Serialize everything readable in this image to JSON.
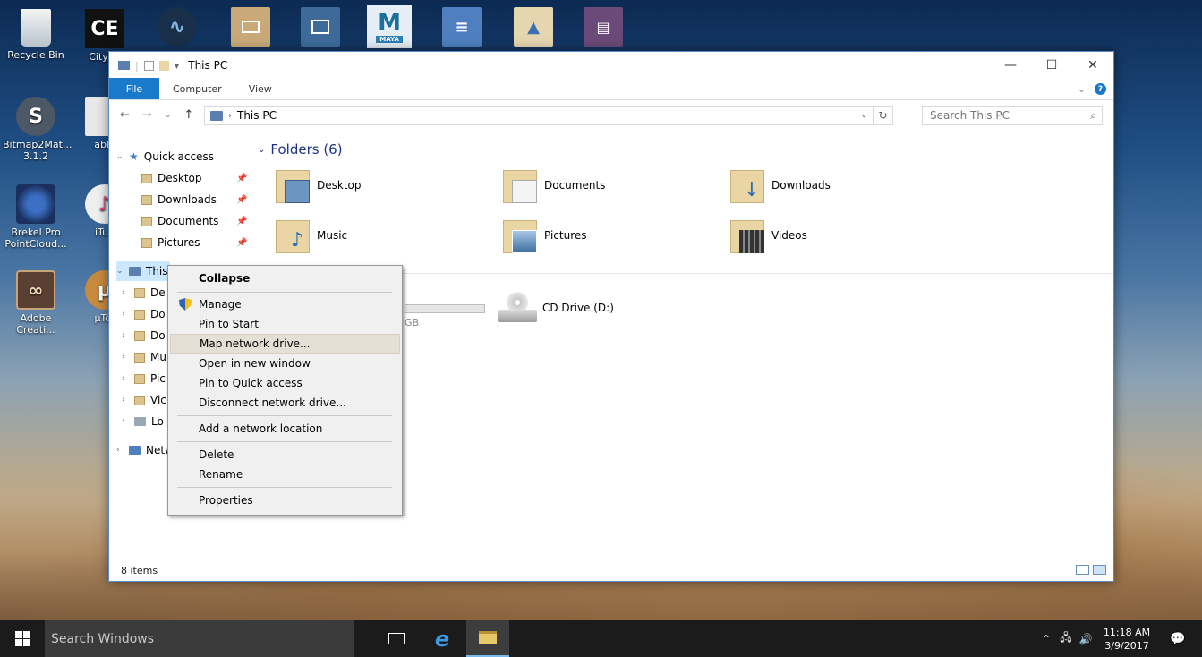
{
  "desktop": {
    "icons_left": [
      {
        "label": "Recycle Bin",
        "icon": "recycle-bin-icon"
      },
      {
        "label": "Bitmap2Mat...\n3.1.2",
        "icon": "bitmap2material-icon"
      },
      {
        "label": "Brekel Pro\nPointCloud...",
        "icon": "brekel-icon"
      },
      {
        "label": "Adobe\nCreati...",
        "icon": "adobe-cc-icon"
      }
    ],
    "icons_col2": [
      {
        "label": "CityEn",
        "icon": "cityengine-icon",
        "glyph": "CE"
      },
      {
        "label": "able",
        "icon": "ableton-icon"
      },
      {
        "label": "iTun",
        "icon": "itunes-icon"
      },
      {
        "label": "µTor",
        "icon": "utorrent-icon"
      }
    ],
    "top_icons": [
      {
        "icon": "nuke-icon"
      },
      {
        "icon": "slideshow-icon"
      },
      {
        "icon": "spreadsheet-icon"
      },
      {
        "icon": "maya-icon",
        "text": "M",
        "subtext": "MAYA"
      },
      {
        "icon": "document-icon"
      },
      {
        "icon": "folder-drive-icon"
      },
      {
        "icon": "winrar-icon"
      }
    ]
  },
  "window": {
    "title": "This PC",
    "controls": {
      "minimize": "—",
      "maximize": "☐",
      "close": "✕"
    },
    "ribbon_tabs": [
      "File",
      "Computer",
      "View"
    ],
    "address": "This PC",
    "search_placeholder": "Search This PC",
    "status": "8 items"
  },
  "navpane": {
    "quick_access": "Quick access",
    "quick_items": [
      "Desktop",
      "Downloads",
      "Documents",
      "Pictures"
    ],
    "this_pc": "This",
    "pc_children": [
      "De",
      "Do",
      "Do",
      "Mu",
      "Pic",
      "Vic",
      "Lo"
    ],
    "network": "Netw"
  },
  "content": {
    "folders_header": "Folders (6)",
    "folders": [
      "Desktop",
      "Documents",
      "Downloads",
      "Music",
      "Pictures",
      "Videos"
    ],
    "drive_fragment": "GB",
    "cd_drive": "CD Drive (D:)"
  },
  "context_menu": {
    "items": [
      {
        "label": "Collapse",
        "bold": true
      },
      {
        "label": "Manage",
        "shield": true
      },
      {
        "label": "Pin to Start"
      },
      {
        "label": "Map network drive...",
        "highlighted": true
      },
      {
        "label": "Open in new window"
      },
      {
        "label": "Pin to Quick access"
      },
      {
        "label": "Disconnect network drive..."
      },
      {
        "label": "Add a network location"
      },
      {
        "label": "Delete"
      },
      {
        "label": "Rename"
      },
      {
        "label": "Properties"
      }
    ]
  },
  "taskbar": {
    "search_placeholder": "Search Windows",
    "time": "11:18 AM",
    "date": "3/9/2017"
  }
}
